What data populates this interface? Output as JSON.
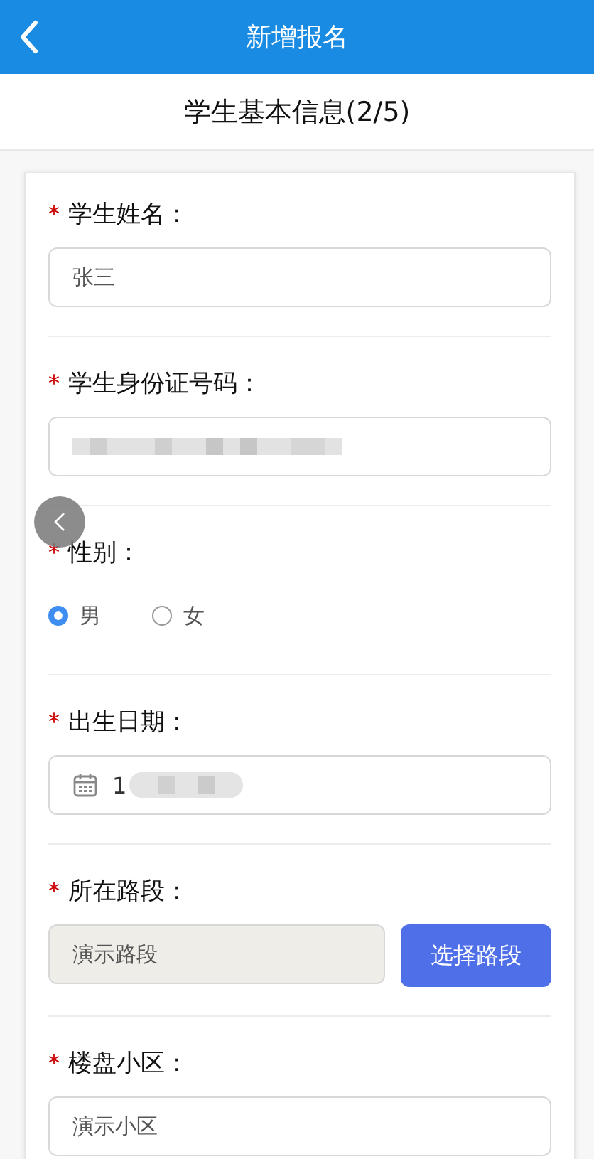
{
  "header": {
    "title": "新增报名"
  },
  "step_title": "学生基本信息(2/5)",
  "fields": [
    {
      "kind": "text",
      "required_mark": "*",
      "label": "学生姓名：",
      "value": "张三"
    },
    {
      "kind": "blurred",
      "required_mark": "*",
      "label": "学生身份证号码："
    },
    {
      "kind": "radio",
      "required_mark": "*",
      "label": "性别：",
      "options": [
        {
          "label": "男",
          "selected": true
        },
        {
          "label": "女",
          "selected": false
        }
      ]
    },
    {
      "kind": "date",
      "required_mark": "*",
      "label": "出生日期：",
      "value": "1"
    },
    {
      "kind": "picker",
      "required_mark": "*",
      "label": "所在路段：",
      "value": "演示路段",
      "button": "选择路段"
    },
    {
      "kind": "text",
      "required_mark": "*",
      "label": "楼盘小区：",
      "value": "演示小区"
    }
  ]
}
